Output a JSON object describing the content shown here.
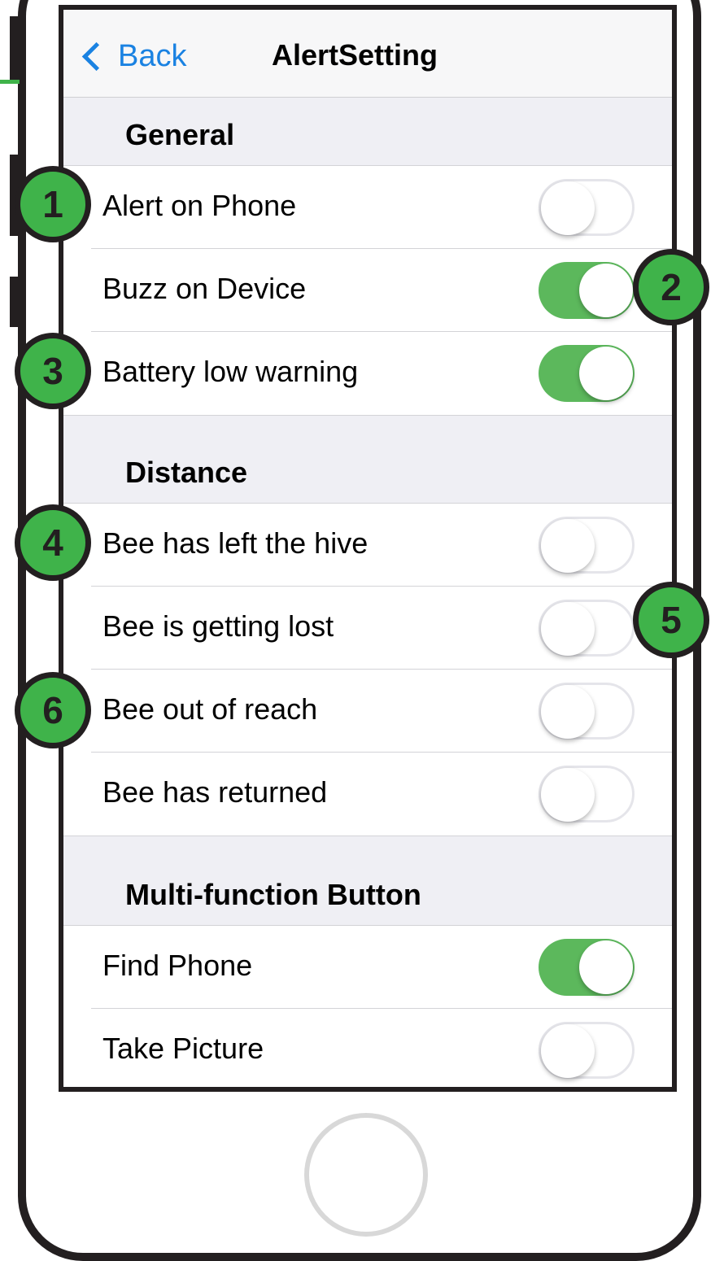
{
  "nav": {
    "back_label": "Back",
    "title": "AlertSetting"
  },
  "sections": [
    {
      "header": "General",
      "rows": [
        {
          "label": "Alert on Phone",
          "on": false
        },
        {
          "label": "Buzz on Device",
          "on": true
        },
        {
          "label": "Battery low warning",
          "on": true
        }
      ]
    },
    {
      "header": "Distance",
      "rows": [
        {
          "label": "Bee has left the hive",
          "on": false
        },
        {
          "label": "Bee is getting lost",
          "on": false
        },
        {
          "label": "Bee out of reach",
          "on": false
        },
        {
          "label": "Bee has returned",
          "on": false
        }
      ]
    },
    {
      "header": "Multi-function Button",
      "rows": [
        {
          "label": "Find Phone",
          "on": true
        },
        {
          "label": "Take Picture",
          "on": false
        }
      ]
    }
  ],
  "badges": [
    "1",
    "2",
    "3",
    "4",
    "5",
    "6"
  ],
  "colors": {
    "accent": "#1a82e2",
    "toggle_on": "#5cb85c",
    "badge": "#3fb34a",
    "frame": "#231f20"
  }
}
